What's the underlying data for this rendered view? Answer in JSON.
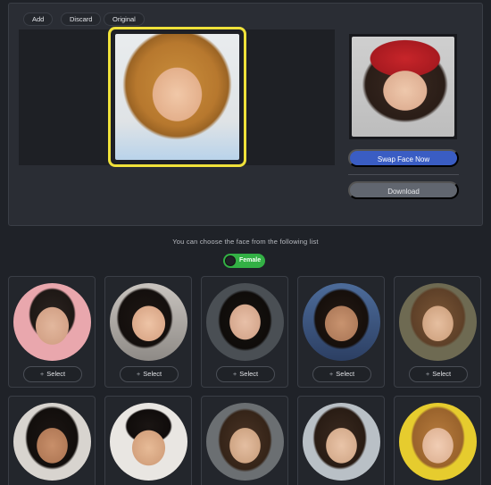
{
  "toolbar": {
    "add_label": "Add",
    "discard_label": "Discard",
    "original_label": "Original"
  },
  "actions": {
    "swap_label": "Swap Face Now",
    "download_label": "Download"
  },
  "hint_text": "You can choose the face from the following list",
  "filter": {
    "label": "Female",
    "enabled": true
  },
  "faces": {
    "select_label": "Select",
    "count": 10
  },
  "colors": {
    "accent_blue": "#3a5dc3",
    "toggle_green": "#33b045",
    "highlight_yellow": "#efe13a",
    "panel_bg": "#2a2d34",
    "page_bg": "#1f2228"
  }
}
